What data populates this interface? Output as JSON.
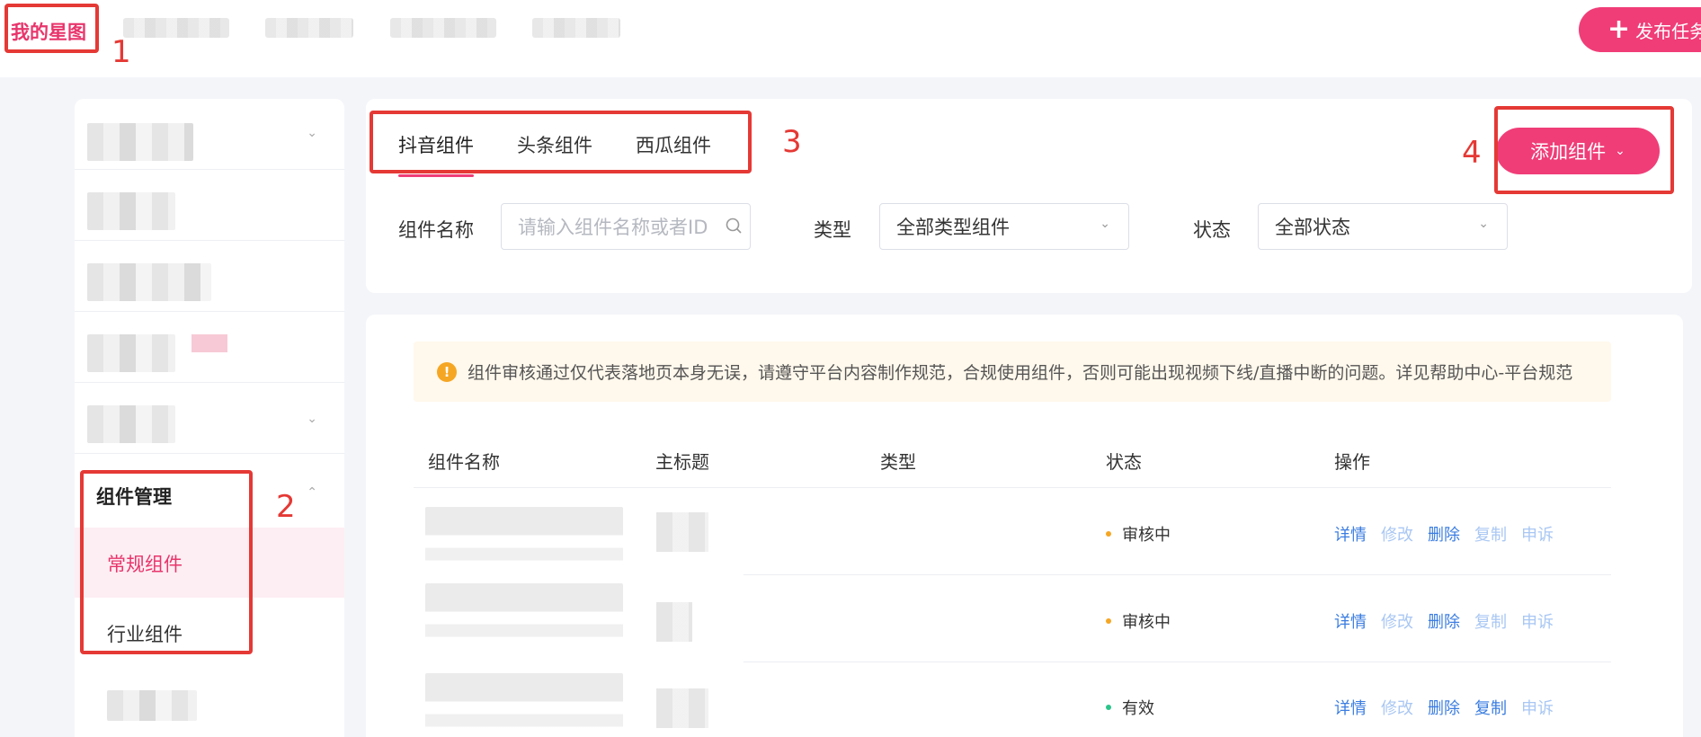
{
  "header": {
    "logo": "我的星图",
    "publish_label": "发布任务"
  },
  "sidebar": {
    "group_label": "组件管理",
    "items": [
      {
        "label": "常规组件",
        "active": true
      },
      {
        "label": "行业组件",
        "active": false
      }
    ]
  },
  "tabs": [
    {
      "label": "抖音组件",
      "active": true
    },
    {
      "label": "头条组件",
      "active": false
    },
    {
      "label": "西瓜组件",
      "active": false
    }
  ],
  "add_button": "添加组件",
  "filters": {
    "name_label": "组件名称",
    "name_placeholder": "请输入组件名称或者ID",
    "type_label": "类型",
    "type_value": "全部类型组件",
    "status_label": "状态",
    "status_value": "全部状态"
  },
  "notice": "组件审核通过仅代表落地页本身无误，请遵守平台内容制作规范，合规使用组件，否则可能出现视频下线/直播中断的问题。详见帮助中心-平台规范",
  "table": {
    "headers": [
      "组件名称",
      "主标题",
      "类型",
      "状态",
      "操作"
    ],
    "rows": [
      {
        "status": "审核中",
        "status_color": "#f5a623",
        "copy_enabled": false
      },
      {
        "status": "审核中",
        "status_color": "#f5a623",
        "copy_enabled": false
      },
      {
        "status": "有效",
        "status_color": "#2bc48a",
        "copy_enabled": true
      }
    ],
    "actions": {
      "detail": "详情",
      "edit": "修改",
      "delete": "删除",
      "copy": "复制",
      "appeal": "申诉"
    }
  },
  "annotations": [
    "1",
    "2",
    "3",
    "4"
  ],
  "colors": {
    "brand": "#f03d78",
    "link": "#3b7de0",
    "link_disabled": "#a9c7f3",
    "annotation": "#e53935"
  }
}
